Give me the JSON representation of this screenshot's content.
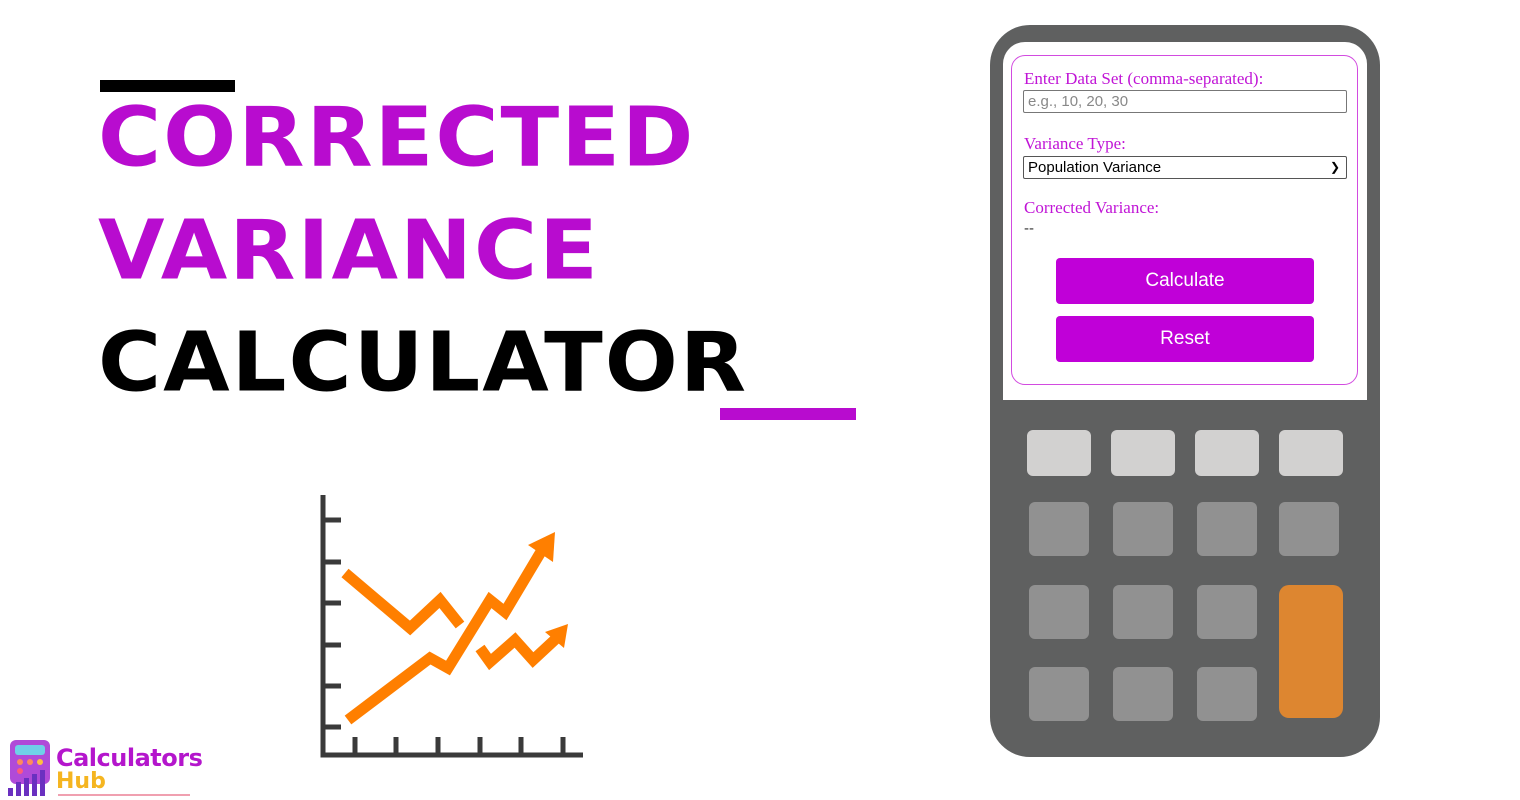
{
  "title": {
    "line1": "CORRECTED",
    "line2": "VARIANCE",
    "line3": "CALCULATOR"
  },
  "colors": {
    "accent": "#b80ccf",
    "calculator_body": "#5f6060",
    "orange_key": "#dd8630",
    "chart_orange": "#ff7f00"
  },
  "form": {
    "data_label": "Enter Data Set (comma-separated):",
    "data_placeholder": "e.g., 10, 20, 30",
    "type_label": "Variance Type:",
    "type_selected": "Population Variance",
    "result_label": "Corrected Variance:",
    "result_value": "--",
    "calculate": "Calculate",
    "reset": "Reset"
  },
  "logo": {
    "line1": "Calculators",
    "line2": "Hub"
  }
}
